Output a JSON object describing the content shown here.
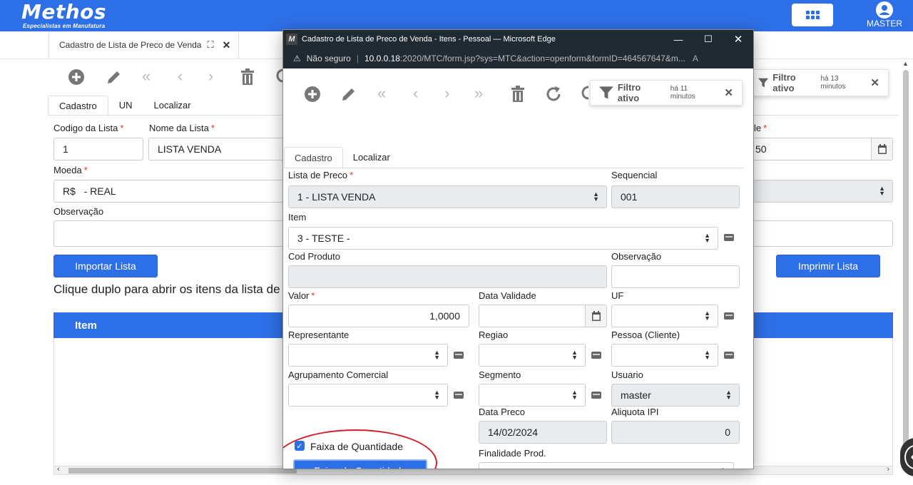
{
  "app": {
    "logo": "Methos",
    "logo_tagline": "Especialistas em Manufatura",
    "user": "MASTER",
    "brand_color": "#2d6fe6"
  },
  "bg": {
    "tab_title": "Cadastro de Lista de Preco de Venda",
    "subtabs": [
      "Cadastro",
      "UN",
      "Localizar"
    ],
    "codigo_label": "Codigo da Lista",
    "codigo_value": "1",
    "nome_label": "Nome da Lista",
    "nome_value": "LISTA VENDA",
    "validade_label_fragment": "le",
    "validade_value_fragment": "50",
    "moeda_label": "Moeda",
    "moeda_value": "R$   - REAL",
    "observacao_label": "Observação",
    "importar_button": "Importar Lista",
    "imprimir_button": "Imprimir Lista",
    "hint": "Clique duplo para abrir os itens da lista de",
    "grid_header": "Item",
    "filter_label": "Filtro ativo",
    "filter_time": "há 13 minutos"
  },
  "win": {
    "title": "Cadastro de Lista de Preco de Venda - Itens - Pessoal — Microsoft Edge",
    "not_secure": "Não seguro",
    "url_host": "10.0.0.18",
    "url_path": ":2020/MTC/form.jsp?sys=MTC&action=openform&formID=464567647&m...",
    "filter_label": "Filtro ativo",
    "filter_time": "há 11 minutos",
    "subtabs": [
      "Cadastro",
      "Localizar"
    ],
    "fields": {
      "lista_label": "Lista de Preco",
      "lista_value": "1 - LISTA VENDA",
      "sequencial_label": "Sequencial",
      "sequencial_value": "001",
      "item_label": "Item",
      "item_value": "3 - TESTE -",
      "cod_produto_label": "Cod Produto",
      "cod_produto_value": "",
      "observacao_label": "Observação",
      "valor_label": "Valor",
      "valor_value": "1,0000",
      "data_validade_label": "Data Validade",
      "uf_label": "UF",
      "representante_label": "Representante",
      "regiao_label": "Regiao",
      "pessoa_label": "Pessoa (Cliente)",
      "agrupamento_label": "Agrupamento Comercial",
      "segmento_label": "Segmento",
      "usuario_label": "Usuario",
      "usuario_value": "master",
      "data_preco_label": "Data Preco",
      "data_preco_value": "14/02/2024",
      "aliquota_label": "Aliquota IPI",
      "aliquota_value": "0",
      "faixa_checkbox_label": "Faixa de Quantidade",
      "faixa_checked": true,
      "faixa_button": "Faixa de Quantidade",
      "finalidade_label": "Finalidade Prod."
    },
    "annotation_color": "#d0202a"
  }
}
